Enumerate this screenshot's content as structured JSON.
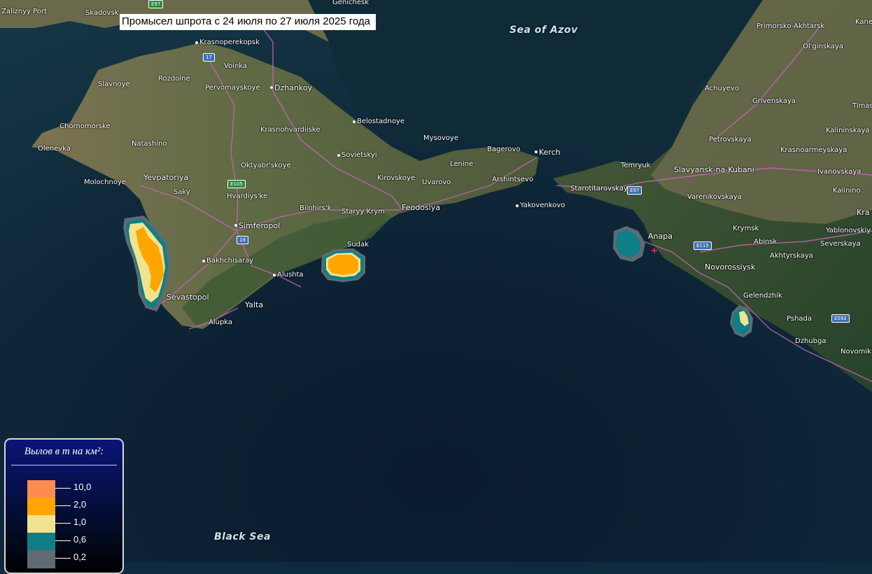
{
  "title": "Промысел шпрота с 24 июля по 27 июля 2025 года",
  "seas": {
    "azov": "Sea of Azov",
    "black": "Black Sea"
  },
  "legend": {
    "title": "Вылов в т на км²:",
    "items": [
      {
        "label": "10,0",
        "color": "#fc8c52"
      },
      {
        "label": "2,0",
        "color": "#ffa500"
      },
      {
        "label": "1,0",
        "color": "#f0e38f"
      },
      {
        "label": "0,6",
        "color": "#0e7f86"
      },
      {
        "label": "0,2",
        "color": "#5f6b73"
      }
    ]
  },
  "places": {
    "zaliznyy_port": "Zaliznyy Port",
    "skadovsk": "Skadovsk",
    "henichesk": "Genichesk",
    "krasnoperekopsk": "Krasnoperekopsk",
    "voinka": "Voinka",
    "rozdolne": "Rozdolne",
    "slavnoye": "Slavnoye",
    "pervomayskoye": "Pervomayskoye",
    "dzhankoy": "Dzhankoy",
    "chornomorske": "Chornomorske",
    "olenevka": "Olenevka",
    "natashino": "Natashino",
    "krasnohvardiiske": "Krasnohvardiiske",
    "belostadnoye": "Belostadnoye",
    "mysovoye": "Mysovoye",
    "yevpatoriya": "Yevpatoriya",
    "molochnoye": "Molochnoye",
    "saky": "Saky",
    "oktyabrskoye": "Oktyabr'skoye",
    "sovietskyi": "Sovietskyi",
    "kirovskoye": "Kirovskoye",
    "hvardiyske": "Hvardiys'ke",
    "simferopol": "Simferopol",
    "bilohirsk": "Bilohirs'k",
    "staryy_krym": "Staryy Krym",
    "feodosiya": "Feodosiya",
    "uvarovo": "Uvarovo",
    "lenine": "Lenine",
    "bagerovo": "Bagerovo",
    "kerch": "Kerch",
    "arshintsevo": "Arshintsevo",
    "yakovenkovo": "Yakovenkovo",
    "sudak": "Sudak",
    "bakhchisaray": "Bakhchisaray",
    "alushta": "Alushta",
    "sevastopol": "Sevastopol",
    "yalta": "Yalta",
    "alupka": "Alupka",
    "temryuk": "Temryuk",
    "starotitarovskaya": "Starotitarovskaya",
    "anapa": "Anapa",
    "slavyansk": "Slavyansk-na-Kubani",
    "varenikovskaya": "Varenikovskaya",
    "krymsk": "Krymsk",
    "abinsk": "Abinsk",
    "akhtyrskaya": "Akhtyrskaya",
    "novorossiysk": "Novorossiysk",
    "gelendzhik": "Gelendzhik",
    "pshada": "Pshada",
    "dzhubga": "Dzhubga",
    "novomikh": "Novomikh",
    "primorsko": "Primorsko-Akhtarsk",
    "olginskaya": "Ol'ginskaya",
    "achuyevo": "Achuyevo",
    "grivenskaya": "Grivenskaya",
    "petrovskaya": "Petrovskaya",
    "krasnoarmeyskaya": "Krasnoarmeyskaya",
    "kalininskaya": "Kalininskaya",
    "ivanovskaya": "Ivanovskaya",
    "kalinino": "Kalinino",
    "yablonovskiy": "Yablonovskiy",
    "severskaya": "Severskaya",
    "kra": "Kra",
    "kane": "Kane",
    "timas": "Timas"
  },
  "shields": {
    "e97a": "E97",
    "r17": "17",
    "e105": "E105",
    "r18": "18",
    "e97b": "E97",
    "e115": "E115",
    "e592": "E592"
  }
}
